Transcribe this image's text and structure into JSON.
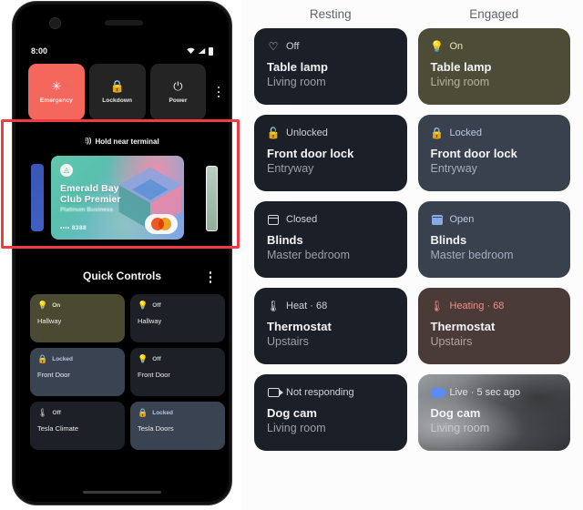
{
  "phone": {
    "status_bar": {
      "time": "8:00",
      "icons": [
        "wifi-icon",
        "signal-icon",
        "battery-icon"
      ]
    },
    "power_menu": {
      "buttons": [
        {
          "label": "Emergency",
          "icon": "emergency-star-icon",
          "accent": "#f4675c"
        },
        {
          "label": "Lockdown",
          "icon": "lock-icon",
          "accent": "#242424"
        },
        {
          "label": "Power",
          "icon": "power-icon",
          "accent": "#242424"
        }
      ],
      "overflow_icon": "kebab-menu-icon"
    },
    "wallet": {
      "hint": "Hold near terminal",
      "nfc_icon": "contactless-nfc-icon",
      "card": {
        "title_line1": "Emerald Bay",
        "title_line2": "Club Premier",
        "subtitle": "Platinum Business",
        "masked_number": "•••• 8388",
        "network_icon": "mastercard-logo",
        "brand_icon": "emerald-bay-logo"
      },
      "side_card_left": "blue-card-edge",
      "side_card_right": "green-card-edge"
    },
    "quick_controls": {
      "title": "Quick Controls",
      "overflow_icon": "kebab-menu-icon",
      "tiles": [
        {
          "state": "On",
          "name": "Hallway",
          "icon": "lightbulb-icon",
          "active": true,
          "kind": "light"
        },
        {
          "state": "Off",
          "name": "Hallway",
          "icon": "lightbulb-icon",
          "active": false,
          "kind": "light"
        },
        {
          "state": "Locked",
          "name": "Front Door",
          "icon": "lock-icon",
          "active": true,
          "kind": "lock"
        },
        {
          "state": "Off",
          "name": "Front Door",
          "icon": "lightbulb-icon",
          "active": false,
          "kind": "light"
        },
        {
          "state": "Off",
          "name": "Tesla Climate",
          "icon": "thermometer-icon",
          "active": false,
          "kind": "climate"
        },
        {
          "state": "Locked",
          "name": "Tesla Doors",
          "icon": "lock-icon",
          "active": true,
          "kind": "lock"
        }
      ]
    }
  },
  "comparison": {
    "columns": [
      {
        "label": "Resting"
      },
      {
        "label": "Engaged"
      }
    ],
    "rows": [
      {
        "resting": {
          "state": "Off",
          "name": "Table lamp",
          "room": "Living room",
          "icon": "lightbulb-outline-icon",
          "style": "off"
        },
        "engaged": {
          "state": "On",
          "name": "Table lamp",
          "room": "Living room",
          "icon": "lightbulb-filled-icon",
          "style": "s-lamp-on"
        }
      },
      {
        "resting": {
          "state": "Unlocked",
          "name": "Front door lock",
          "room": "Entryway",
          "icon": "unlock-outline-icon",
          "style": "off"
        },
        "engaged": {
          "state": "Locked",
          "name": "Front door lock",
          "room": "Entryway",
          "icon": "lock-filled-icon",
          "style": "s-lock-on"
        }
      },
      {
        "resting": {
          "state": "Closed",
          "name": "Blinds",
          "room": "Master bedroom",
          "icon": "blinds-outline-icon",
          "style": "off"
        },
        "engaged": {
          "state": "Open",
          "name": "Blinds",
          "room": "Master bedroom",
          "icon": "blinds-filled-icon",
          "style": "s-blind-on"
        }
      },
      {
        "resting": {
          "state": "Heat · 68",
          "name": "Thermostat",
          "room": "Upstairs",
          "icon": "thermometer-outline-icon",
          "style": "off"
        },
        "engaged": {
          "state": "Heating · 68",
          "name": "Thermostat",
          "room": "Upstairs",
          "icon": "thermometer-filled-icon",
          "style": "s-heat-on"
        }
      },
      {
        "resting": {
          "state": "Not responding",
          "name": "Dog cam",
          "room": "Living room",
          "icon": "camera-outline-icon",
          "style": "off"
        },
        "engaged": {
          "state": "Live · 5 sec ago",
          "name": "Dog cam",
          "room": "Living room",
          "icon": "camera-filled-icon",
          "style": "s-cam-on"
        }
      }
    ]
  },
  "colors": {
    "highlight": "#ef3b42",
    "card_off_bg": "#1b1f27",
    "lamp_on_bg": "#4c4c37",
    "lock_on_bg": "#39414f",
    "heat_on_bg": "#4a3a38",
    "emergency": "#f4675c"
  }
}
